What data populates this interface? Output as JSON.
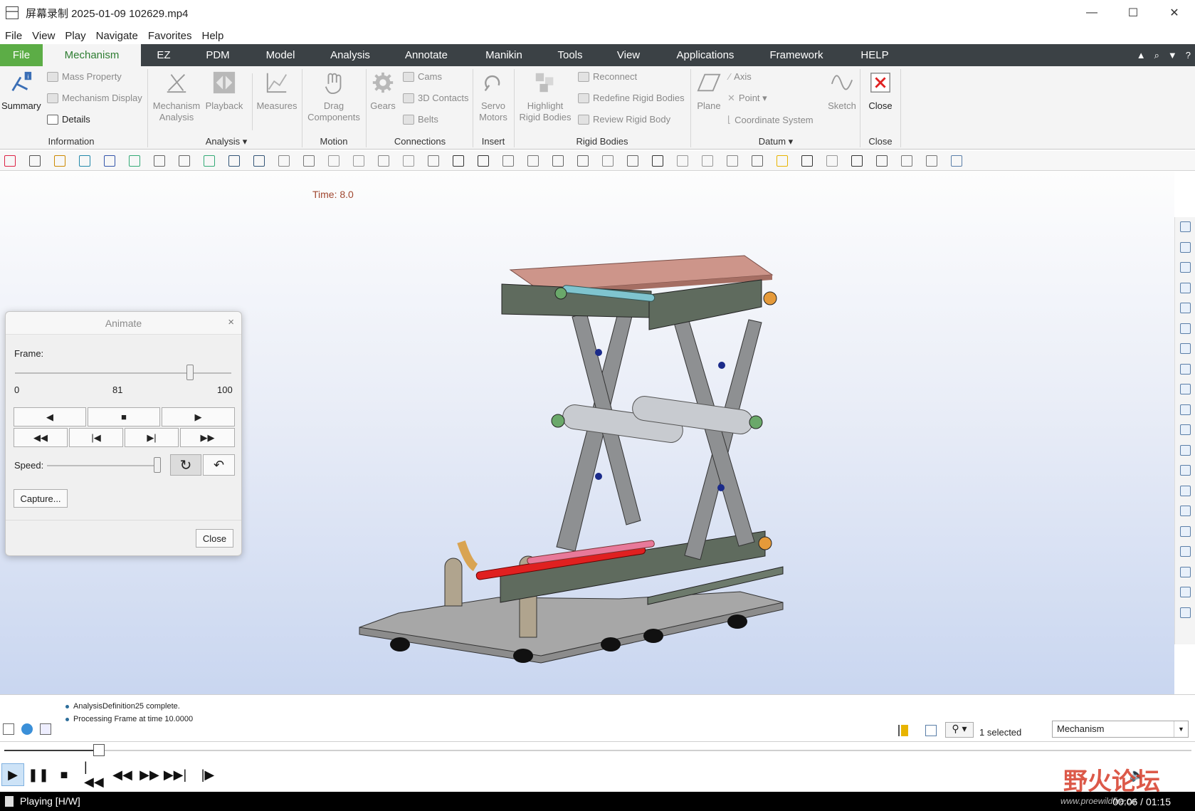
{
  "window": {
    "title": "屏幕录制 2025-01-09 102629.mp4",
    "minimize": "—",
    "maximize": "☐",
    "close": "✕"
  },
  "menu": [
    "File",
    "View",
    "Play",
    "Navigate",
    "Favorites",
    "Help"
  ],
  "ribbon_tabs": [
    "File",
    "Mechanism",
    "EZ",
    "PDM",
    "Model",
    "Analysis",
    "Annotate",
    "Manikin",
    "Tools",
    "View",
    "Applications",
    "Framework",
    "HELP"
  ],
  "ribbon": {
    "summary": "Summary",
    "mass_property": "Mass Property",
    "mechanism_display": "Mechanism Display",
    "details": "Details",
    "information": "Information",
    "mechanism_analysis_1": "Mechanism",
    "mechanism_analysis_2": "Analysis",
    "playback": "Playback",
    "measures": "Measures",
    "analysis_group": "Analysis ▾",
    "drag_1": "Drag",
    "drag_2": "Components",
    "motion": "Motion",
    "gears": "Gears",
    "cams": "Cams",
    "contacts_3d": "3D Contacts",
    "belts": "Belts",
    "connections": "Connections",
    "servo_1": "Servo",
    "servo_2": "Motors",
    "insert": "Insert",
    "highlight_1": "Highlight",
    "highlight_2": "Rigid Bodies",
    "reconnect": "Reconnect",
    "redefine": "Redefine Rigid Bodies",
    "review": "Review Rigid Body",
    "rigid_bodies": "Rigid Bodies",
    "plane": "Plane",
    "axis": "Axis",
    "point": "Point ▾",
    "coordinate_system": "Coordinate System",
    "sketch": "Sketch",
    "datum": "Datum ▾",
    "close": "Close",
    "close_group": "Close"
  },
  "viewport": {
    "time_label": "Time: 8.0"
  },
  "animate": {
    "title": "Animate",
    "close_x": "×",
    "frame_label": "Frame:",
    "frame_min": "0",
    "frame_value": "81",
    "frame_max": "100",
    "frame_fraction": 0.81,
    "speed_label": "Speed:",
    "speed_fraction": 1.0,
    "capture": "Capture...",
    "close": "Close"
  },
  "messages": [
    "AnalysisDefinition25 complete.",
    "Processing Frame at time 10.0000"
  ],
  "status": {
    "selected": "1 selected",
    "filter": "Mechanism"
  },
  "player": {
    "progress_fraction": 0.08,
    "state": "Playing [H/W]",
    "time": "00:06 / 01:15"
  },
  "watermark": {
    "text": "野火论坛",
    "url": "www.proewildfire.cn"
  },
  "colors": {
    "ribbon_dark": "#3b4145",
    "file_tab": "#5cad46",
    "active_tab_text": "#2e7d32",
    "plate_top": "#c98b7e",
    "frame_green": "#5f6b5e",
    "arm_gray": "#8e9092",
    "rod_red": "#e02020"
  }
}
